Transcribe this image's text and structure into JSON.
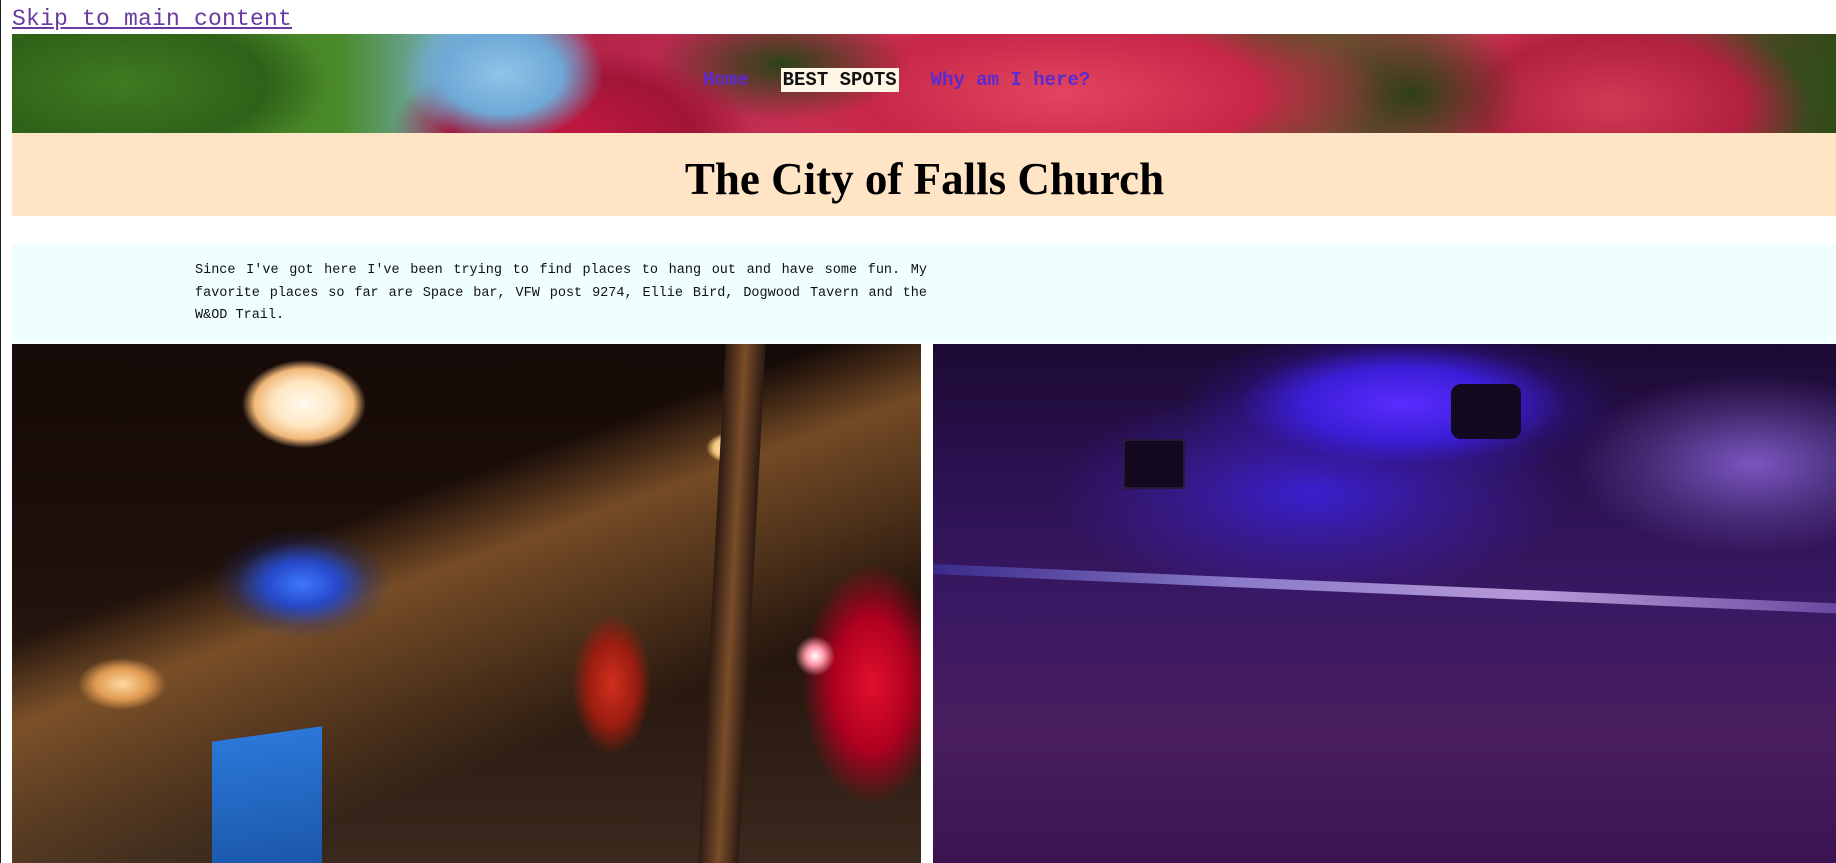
{
  "skip_link": "Skip to main content",
  "nav": {
    "items": [
      {
        "label": "Home",
        "active": false
      },
      {
        "label": "BEST SPOTS",
        "active": true
      },
      {
        "label": "Why am I here?",
        "active": false
      }
    ]
  },
  "page_title": "The City of Falls Church",
  "intro_text": "Since I've got here I've been trying to find places to hang out and have some fun. My favorite places so far are Space bar, VFW post 9274, Ellie Bird, Dogwood Tavern and the W&OD Trail.",
  "colors": {
    "link": "#5b2bd0",
    "title_band": "#ffe4c6",
    "intro_band": "#effeff"
  }
}
